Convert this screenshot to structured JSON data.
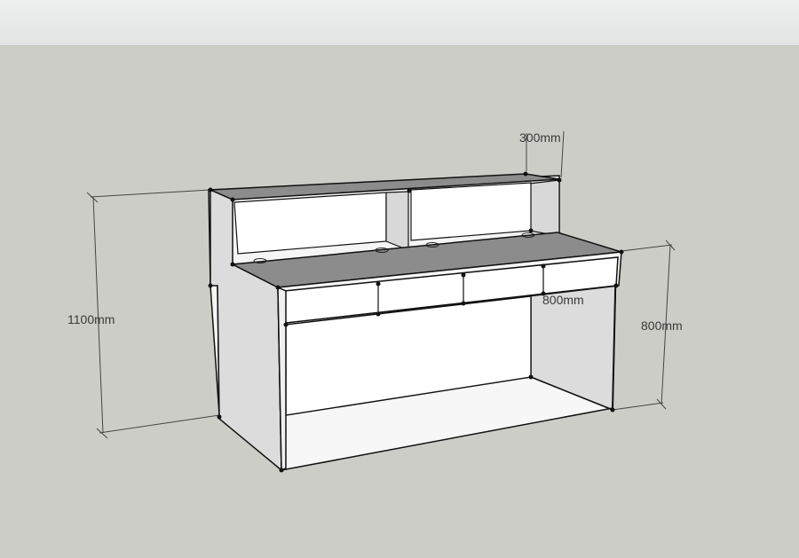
{
  "viewport": {
    "background_color": "#cdcdc8",
    "toolbar_color": "#e8eaea"
  },
  "model": {
    "object": "reception desk",
    "panel_color": "#f6f6f6",
    "side_panel_color": "#dcdcdc",
    "top_surface_color": "#8c8c8c",
    "edge_color": "#111111"
  },
  "dimensions": {
    "overall_height": "1100mm",
    "desk_height": "800mm",
    "desk_depth": "800mm",
    "shelf_depth": "300mm"
  }
}
